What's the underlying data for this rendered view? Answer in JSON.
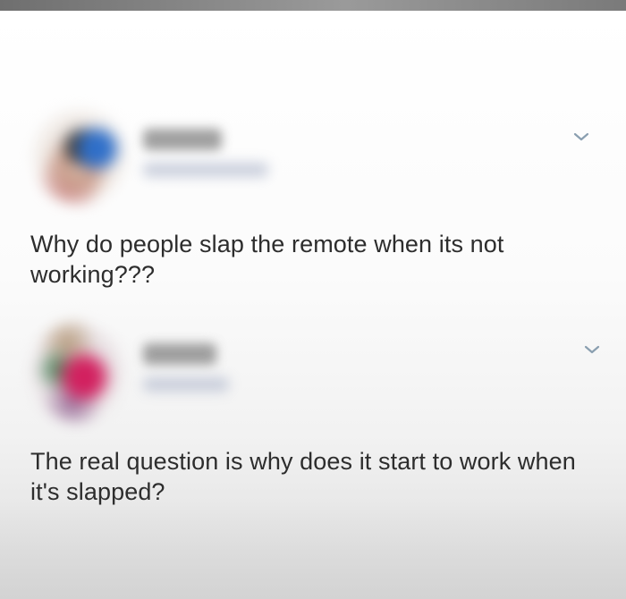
{
  "feed": {
    "posts": [
      {
        "author_name": "",
        "text": "Why do people slap the remote when its not working???",
        "menu_icon": "chevron-down-icon"
      },
      {
        "author_name": "",
        "text": "The real question is why does it start to work when it's slapped?",
        "menu_icon": "chevron-down-icon"
      }
    ]
  },
  "colors": {
    "text": "#2d2d2d",
    "chevron": "#8a9fb0",
    "background": "#ffffff"
  }
}
